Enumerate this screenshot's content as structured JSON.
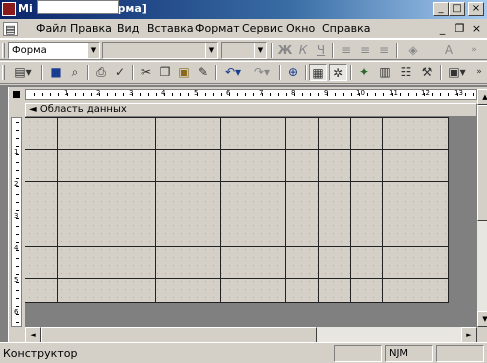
{
  "window": {
    "title": "Mi                   Форма1 : форма]",
    "minimize_icon": "_",
    "maximize_icon": "□",
    "close_icon": "×"
  },
  "menu": {
    "items": [
      "Файл",
      "Правка",
      "Вид",
      "Вставка",
      "Формат",
      "Сервис",
      "Окно",
      "Справка"
    ],
    "doc_minimize_icon": "_",
    "doc_restore_icon": "❐",
    "doc_close_icon": "×"
  },
  "format_toolbar": {
    "object_combo_value": "Форма",
    "font_combo_value": "",
    "size_combo_value": "",
    "bold_label": "Ж",
    "italic_label": "К",
    "underline_label": "Ч",
    "fill_color_icon": "◈",
    "font_color_label": "A",
    "combo_arrow": "▼"
  },
  "form_design_toolbar": {
    "icons": [
      "view-icon",
      "save-icon",
      "print-preview-icon",
      "print-icon",
      "spelling-icon",
      "cut-icon",
      "copy-icon",
      "paste-icon",
      "format-painter-icon",
      "undo-icon",
      "redo-icon",
      "insert-hyperlink-icon",
      "field-list-icon",
      "toolbox-icon",
      "autoformat-icon",
      "code-icon",
      "properties-icon",
      "build-icon",
      "database-window-icon"
    ]
  },
  "form": {
    "section_label": "◄ Область данных",
    "h_ruler_numbers": [
      "1",
      "2",
      "3",
      "4",
      "5",
      "6",
      "7",
      "8",
      "9",
      "10",
      "11",
      "12",
      "13"
    ],
    "v_ruler_numbers": [
      "1",
      "2",
      "3",
      "4",
      "5",
      "6"
    ]
  },
  "statusbar": {
    "mode": "Конструктор",
    "num_lock": "NJM"
  },
  "scroll": {
    "up": "▲",
    "down": "▼",
    "left": "◄",
    "right": "►"
  }
}
